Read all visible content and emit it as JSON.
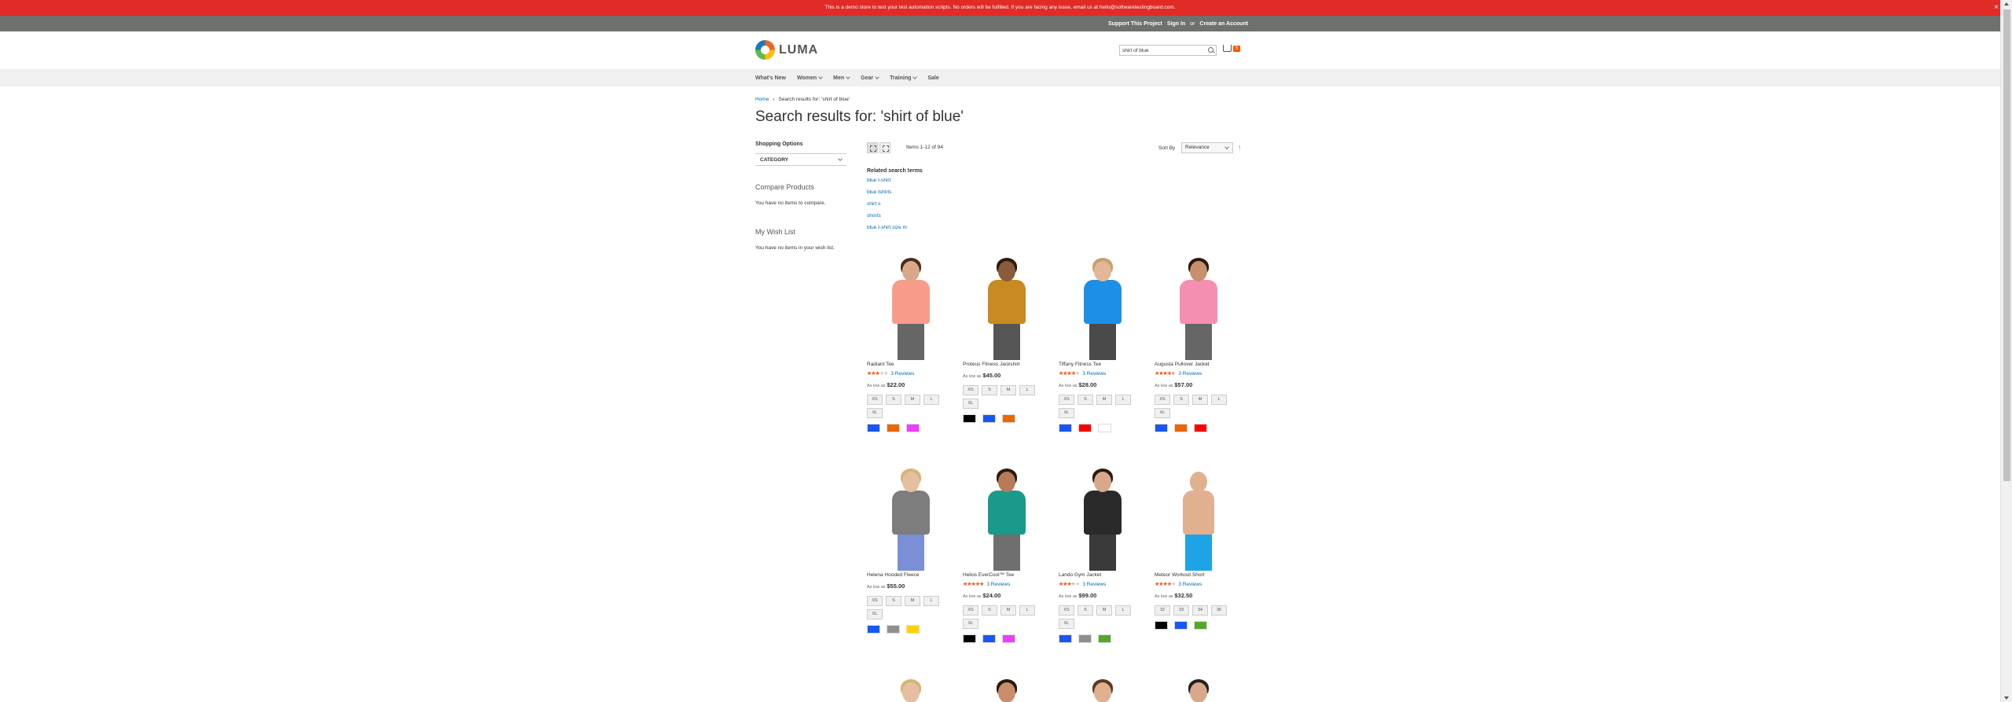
{
  "banner": {
    "text": "This is a demo store to test your test automation scripts. No orders will be fulfilled. If you are facing any issue, email us at hello@softwaretestingboard.com."
  },
  "top_links": {
    "support": "Support This Project",
    "sign_in": "Sign In",
    "or": "or",
    "create": "Create an Account"
  },
  "header": {
    "logo_text": "LUMA",
    "search_value": "shirt of blue",
    "cart_count": "5"
  },
  "nav": [
    {
      "label": "What's New",
      "has_menu": false
    },
    {
      "label": "Women",
      "has_menu": true
    },
    {
      "label": "Men",
      "has_menu": true
    },
    {
      "label": "Gear",
      "has_menu": true
    },
    {
      "label": "Training",
      "has_menu": true
    },
    {
      "label": "Sale",
      "has_menu": false
    }
  ],
  "breadcrumb": {
    "home": "Home",
    "sep": "›",
    "current": "Search results for: 'shirt of blue'"
  },
  "page_title": "Search results for: 'shirt of blue'",
  "sidebar": {
    "shopping_options": "Shopping Options",
    "category": "CATEGORY",
    "compare_title": "Compare Products",
    "compare_text": "You have no items to compare.",
    "wishlist_title": "My Wish List",
    "wishlist_text": "You have no items in your wish list."
  },
  "toolbar": {
    "amount": "Items 1-12 of 94",
    "sort_label": "Sort By",
    "sort_value": "Relevance",
    "sort_dir_icon": "arrow-up-icon"
  },
  "related": {
    "title": "Related search terms",
    "terms": [
      "blue t-shirt",
      "blue tshirts",
      "shirt s",
      "shorts",
      "blue t-shirt size m"
    ]
  },
  "products": [
    {
      "name": "Radiant Tee",
      "rating_pct": 60,
      "reviews": "3 Reviews",
      "as_low": "As low as",
      "price": "$22.00",
      "sizes": [
        "XS",
        "S",
        "M",
        "L",
        "XL"
      ],
      "colors": [
        "#1857f7",
        "#eb6703",
        "#ef3dff"
      ],
      "shirt": "#f99b8b",
      "skin": "#d9a88a",
      "hair": "#4a2d1d",
      "legs": "#666666"
    },
    {
      "name": "Proteus Fitness Jackshirt",
      "rating_pct": 0,
      "reviews": "",
      "as_low": "As low as",
      "price": "$45.00",
      "sizes": [
        "XS",
        "S",
        "M",
        "L",
        "XL"
      ],
      "colors": [
        "#000000",
        "#1857f7",
        "#eb6703"
      ],
      "shirt": "#c98a22",
      "skin": "#8a5a3c",
      "hair": "#2b1a10",
      "legs": "#555555"
    },
    {
      "name": "Tiffany Fitness Tee",
      "rating_pct": 80,
      "reviews": "3 Reviews",
      "as_low": "As low as",
      "price": "$28.00",
      "sizes": [
        "XS",
        "S",
        "M",
        "L",
        "XL"
      ],
      "colors": [
        "#1857f7",
        "#ff0000",
        "#ffffff"
      ],
      "shirt": "#1e8fe6",
      "skin": "#e2b697",
      "hair": "#c7a06b",
      "legs": "#4a4a4a"
    },
    {
      "name": "Augusta Pullover Jacket",
      "rating_pct": 90,
      "reviews": "3 Reviews",
      "as_low": "As low as",
      "price": "$57.00",
      "sizes": [
        "XS",
        "S",
        "M",
        "L",
        "XL"
      ],
      "colors": [
        "#1857f7",
        "#eb6703",
        "#ff0000"
      ],
      "shirt": "#f58fb2",
      "skin": "#c98f6c",
      "hair": "#2b1a10",
      "legs": "#666666"
    },
    {
      "name": "Helena Hooded Fleece",
      "rating_pct": 0,
      "reviews": "",
      "as_low": "As low as",
      "price": "$55.00",
      "sizes": [
        "XS",
        "S",
        "M",
        "L",
        "XL"
      ],
      "colors": [
        "#1857f7",
        "#8f8f8f",
        "#ffd500"
      ],
      "shirt": "#7d7d7d",
      "skin": "#e6bfa0",
      "hair": "#d3b47a",
      "legs": "#7a8fd6"
    },
    {
      "name": "Helios EverCool™ Tee",
      "rating_pct": 100,
      "reviews": "3 Reviews",
      "as_low": "As low as",
      "price": "$24.00",
      "sizes": [
        "XS",
        "S",
        "M",
        "L",
        "XL"
      ],
      "colors": [
        "#000000",
        "#1857f7",
        "#ef3dff"
      ],
      "shirt": "#1a9a8a",
      "skin": "#b87a57",
      "hair": "#2b1a10",
      "legs": "#6f6f6f"
    },
    {
      "name": "Lando Gym Jacket",
      "rating_pct": 70,
      "reviews": "3 Reviews",
      "as_low": "As low as",
      "price": "$99.00",
      "sizes": [
        "XS",
        "S",
        "M",
        "L",
        "XL"
      ],
      "colors": [
        "#1857f7",
        "#8f8f8f",
        "#53a828"
      ],
      "shirt": "#2a2a2a",
      "skin": "#d9a88a",
      "hair": "#2b1a10",
      "legs": "#3a3a3a"
    },
    {
      "name": "Meteor Workout Short",
      "rating_pct": 80,
      "reviews": "3 Reviews",
      "as_low": "As low as",
      "price": "$32.50",
      "sizes": [
        "32",
        "33",
        "34",
        "36"
      ],
      "colors": [
        "#000000",
        "#1857f7",
        "#53a828"
      ],
      "shirt": "#ffffff",
      "skin": "#e0b08f",
      "hair": "#ffffff",
      "legs": "#1ea3e6"
    }
  ],
  "next_row": [
    {
      "skin": "#e6bfa0",
      "hair": "#d3b47a"
    },
    {
      "skin": "#c98f6c",
      "hair": "#2b1a10"
    },
    {
      "skin": "#e0b08f",
      "hair": "#5a3a26"
    },
    {
      "skin": "#d9a88a",
      "hair": "#222222"
    }
  ]
}
